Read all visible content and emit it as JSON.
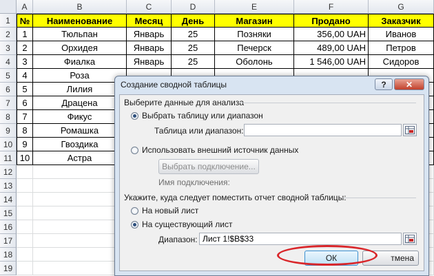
{
  "columns": [
    "A",
    "B",
    "C",
    "D",
    "E",
    "F",
    "G"
  ],
  "rows": [
    "1",
    "2",
    "3",
    "4",
    "5",
    "6",
    "7",
    "8",
    "9",
    "10",
    "11",
    "12",
    "13",
    "14",
    "15",
    "16",
    "17",
    "18",
    "19"
  ],
  "headers": [
    "№",
    "Наименование",
    "Месяц",
    "День",
    "Магазин",
    "Продано",
    "Заказчик"
  ],
  "data_rows": [
    [
      "1",
      "Тюльпан",
      "Январь",
      "25",
      "Позняки",
      "356,00 UAH",
      "Иванов"
    ],
    [
      "2",
      "Орхидея",
      "Январь",
      "25",
      "Печерск",
      "489,00 UAH",
      "Петров"
    ],
    [
      "3",
      "Фиалка",
      "Январь",
      "25",
      "Оболонь",
      "1 546,00 UAH",
      "Сидоров"
    ],
    [
      "4",
      "Роза",
      "",
      "",
      "",
      "",
      ""
    ],
    [
      "5",
      "Лилия",
      "",
      "",
      "",
      "",
      ""
    ],
    [
      "6",
      "Драцена",
      "",
      "",
      "",
      "",
      ""
    ],
    [
      "7",
      "Фикус",
      "",
      "",
      "",
      "",
      ""
    ],
    [
      "8",
      "Ромашка",
      "",
      "",
      "",
      "",
      ""
    ],
    [
      "9",
      "Гвоздика",
      "",
      "",
      "",
      "",
      ""
    ],
    [
      "10",
      "Астра",
      "",
      "",
      "",
      "",
      ""
    ]
  ],
  "colors": {
    "header_fill": "#ffff00",
    "dialog_bg": "#d8e4f2",
    "highlight": "#d9262a"
  },
  "dialog": {
    "title": "Создание сводной таблицы",
    "help_label": "?",
    "close_label": "✕",
    "section1": "Выберите данные для анализа",
    "radio_table": "Выбрать таблицу или диапазон",
    "table_range_label": "Таблица или диапазон:",
    "table_range_value": "",
    "radio_external": "Использовать внешний источник данных",
    "choose_connection": "Выбрать подключение...",
    "connection_name_label": "Имя подключения:",
    "section2": "Укажите, куда следует поместить отчет сводной таблицы:",
    "radio_new_sheet": "На новый лист",
    "radio_existing_sheet": "На существующий лист",
    "range_label": "Диапазон:",
    "range_value": "Лист 1!$B$33",
    "ok_label": "ОК",
    "cancel_label": "тмена"
  }
}
